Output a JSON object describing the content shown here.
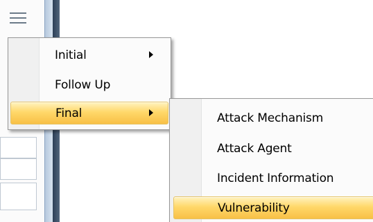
{
  "main_menu": {
    "items": [
      {
        "label": "Initial",
        "has_submenu": true,
        "highlighted": false
      },
      {
        "label": "Follow Up",
        "has_submenu": false,
        "highlighted": false
      },
      {
        "label": "Final",
        "has_submenu": true,
        "highlighted": true
      }
    ]
  },
  "sub_menu": {
    "items": [
      {
        "label": "Attack Mechanism",
        "highlighted": false
      },
      {
        "label": "Attack Agent",
        "highlighted": false
      },
      {
        "label": "Incident Information",
        "highlighted": false
      },
      {
        "label": "Vulnerability",
        "highlighted": true
      }
    ]
  },
  "icons": {
    "menu": "hamburger-menu-icon",
    "submenu_arrow": "triangle-right-icon"
  },
  "colors": {
    "highlight_top": "#fff3bf",
    "highlight_bottom": "#f8c046",
    "highlight_border": "#e5c365",
    "menu_background": "#f0f0f0"
  }
}
